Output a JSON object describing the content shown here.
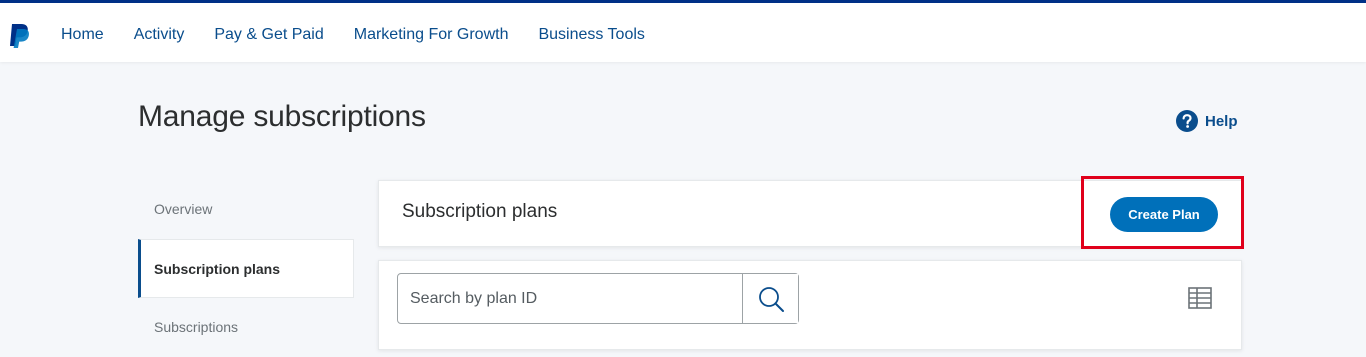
{
  "brand": {
    "logo_icon": "paypal-logo-icon",
    "accent": "#003087",
    "link_color": "#0a4d8c",
    "button_color": "#0070ba"
  },
  "nav": {
    "items": [
      {
        "label": "Home"
      },
      {
        "label": "Activity"
      },
      {
        "label": "Pay & Get Paid"
      },
      {
        "label": "Marketing For Growth"
      },
      {
        "label": "Business Tools"
      }
    ]
  },
  "page": {
    "title": "Manage subscriptions"
  },
  "help": {
    "label": "Help",
    "icon": "help-circle-icon"
  },
  "sidebar": {
    "items": [
      {
        "label": "Overview",
        "active": false
      },
      {
        "label": "Subscription plans",
        "active": true
      },
      {
        "label": "Subscriptions",
        "active": false
      }
    ]
  },
  "plans_card": {
    "title": "Subscription plans",
    "create_button_label": "Create Plan",
    "highlight_color": "#e0001b"
  },
  "search": {
    "placeholder": "Search by plan ID",
    "value": "",
    "search_icon": "search-icon",
    "view_toggle_icon": "table-view-icon"
  }
}
